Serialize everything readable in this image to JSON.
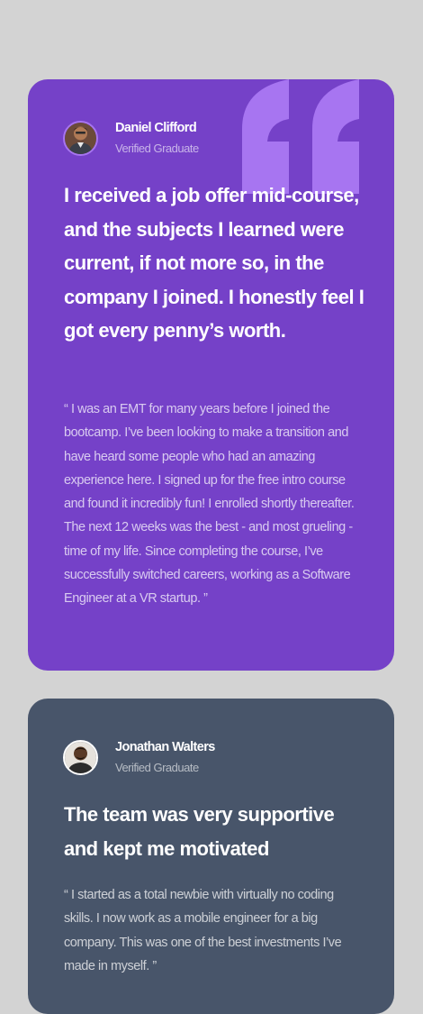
{
  "testimonials": [
    {
      "name": "Daniel Clifford",
      "status": "Verified Graduate",
      "headline": "I received a job offer mid-course, and the subjects I learned were current, if not more so, in the company I joined. I honestly feel I got every penny’s worth.",
      "body": "“ I was an EMT for many years before I joined the bootcamp. I’ve been looking to make a transition and have heard some people who had an amazing experience here. I signed up for the free intro course and found it incredibly fun! I enrolled shortly thereafter. The next 12 weeks was the best - and most grueling - time of my life. Since completing the course, I’ve successfully switched careers, working as a Software Engineer at a VR startup. ”",
      "card_color": "#7541c8"
    },
    {
      "name": "Jonathan Walters",
      "status": "Verified Graduate",
      "headline": "The team was very supportive and kept me motivated",
      "body": "“ I started as a total newbie with virtually no coding skills. I now work as a mobile engineer for a big company. This was one of the best investments I’ve made in myself. ”",
      "card_color": "#48556a"
    }
  ],
  "colors": {
    "page_background": "#d3d3d3",
    "quote_mark": "#a775f1"
  },
  "icons": {
    "quote": "quotation-mark-icon"
  }
}
